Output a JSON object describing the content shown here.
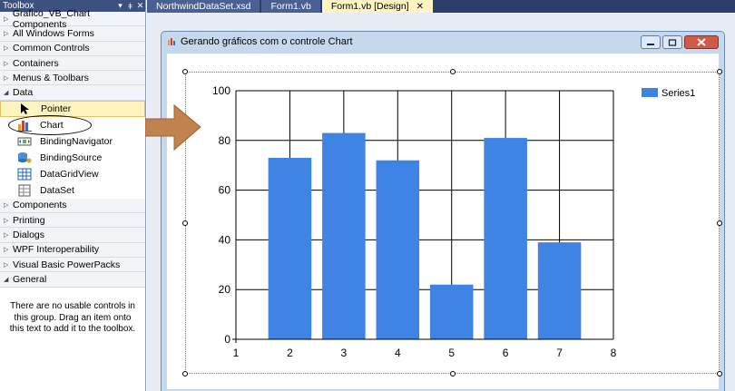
{
  "toolbox": {
    "title": "Toolbox",
    "title_controls": [
      "▾",
      "ǂ",
      "✕"
    ],
    "groups_top": [
      {
        "label": "Grafico_VB_Chart Components",
        "expanded": false
      },
      {
        "label": "All Windows Forms",
        "expanded": false
      },
      {
        "label": "Common Controls",
        "expanded": false
      },
      {
        "label": "Containers",
        "expanded": false
      },
      {
        "label": "Menus & Toolbars",
        "expanded": false
      },
      {
        "label": "Data",
        "expanded": true
      }
    ],
    "data_items": [
      {
        "label": "Pointer",
        "icon": "pointer-icon",
        "selected": true
      },
      {
        "label": "Chart",
        "icon": "chart-icon",
        "selected": false
      },
      {
        "label": "BindingNavigator",
        "icon": "binding-navigator-icon",
        "selected": false
      },
      {
        "label": "BindingSource",
        "icon": "binding-source-icon",
        "selected": false
      },
      {
        "label": "DataGridView",
        "icon": "datagridview-icon",
        "selected": false
      },
      {
        "label": "DataSet",
        "icon": "dataset-icon",
        "selected": false
      }
    ],
    "groups_bottom": [
      {
        "label": "Components",
        "expanded": false
      },
      {
        "label": "Printing",
        "expanded": false
      },
      {
        "label": "Dialogs",
        "expanded": false
      },
      {
        "label": "WPF Interoperability",
        "expanded": false
      },
      {
        "label": "Visual Basic PowerPacks",
        "expanded": false
      },
      {
        "label": "General",
        "expanded": true
      }
    ],
    "empty_message": "There are no usable controls in this group. Drag an item onto this text to add it to the toolbox."
  },
  "tabs": [
    {
      "label": "NorthwindDataSet.xsd",
      "active": false
    },
    {
      "label": "Form1.vb",
      "active": false
    },
    {
      "label": "Form1.vb [Design]",
      "active": true,
      "close": "✕"
    }
  ],
  "form": {
    "title": "Gerando gráficos com o controle Chart",
    "buttons": [
      "minimize",
      "maximize",
      "close"
    ]
  },
  "colors": {
    "series": "#3f84e5",
    "toolbox_title": "#3c517f",
    "arrow": "#c0824f"
  },
  "chart_data": {
    "type": "bar",
    "series": [
      {
        "name": "Series1",
        "x": [
          2,
          3,
          4,
          5,
          6,
          7
        ],
        "values": [
          73,
          83,
          72,
          22,
          81,
          39
        ]
      }
    ],
    "xlim": [
      1,
      8
    ],
    "ylim": [
      0,
      100
    ],
    "xticks": [
      "1",
      "2",
      "3",
      "4",
      "5",
      "6",
      "7",
      "8"
    ],
    "yticks": [
      "0",
      "20",
      "40",
      "60",
      "80",
      "100"
    ],
    "grid": true,
    "legend": "top-right"
  }
}
